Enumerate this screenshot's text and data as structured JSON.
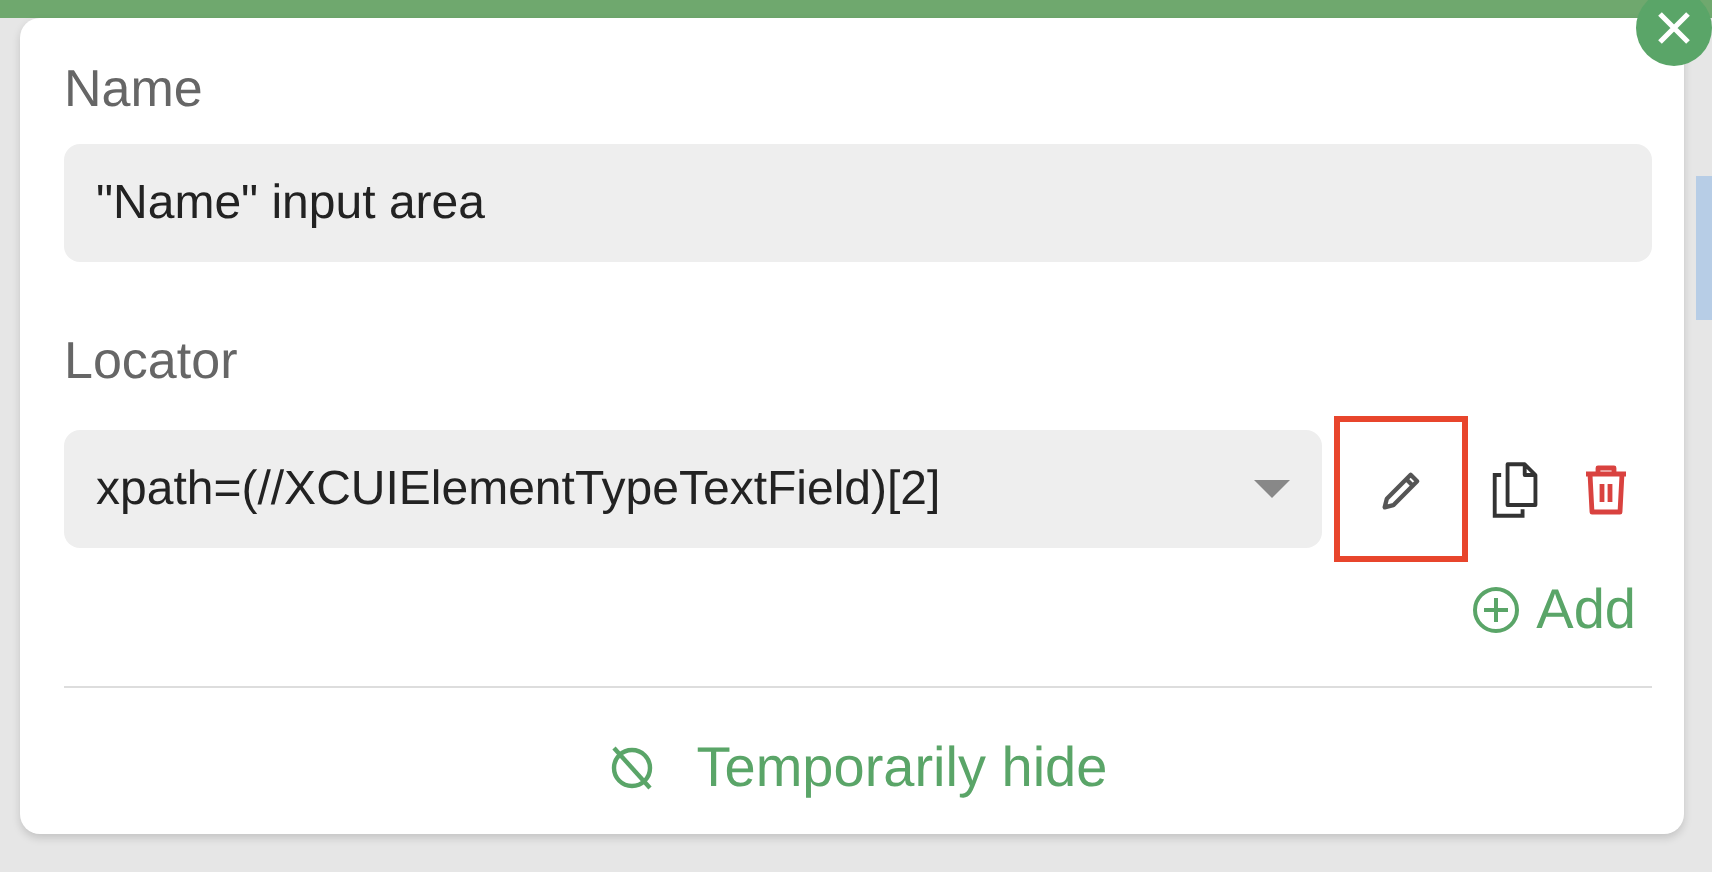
{
  "fields": [
    {
      "kind": "text",
      "label": "Name",
      "value": "\"Name\" input area"
    },
    {
      "kind": "select",
      "label": "Locator",
      "value": "xpath=(//XCUIElementTypeTextField)[2]"
    }
  ],
  "actions": [
    {
      "kind": "edit",
      "highlighted": true
    },
    {
      "kind": "copy",
      "highlighted": false
    },
    {
      "kind": "delete",
      "highlighted": false
    }
  ],
  "add_button": {
    "label": "Add"
  },
  "footer_button": {
    "label": "Temporarily hide"
  }
}
